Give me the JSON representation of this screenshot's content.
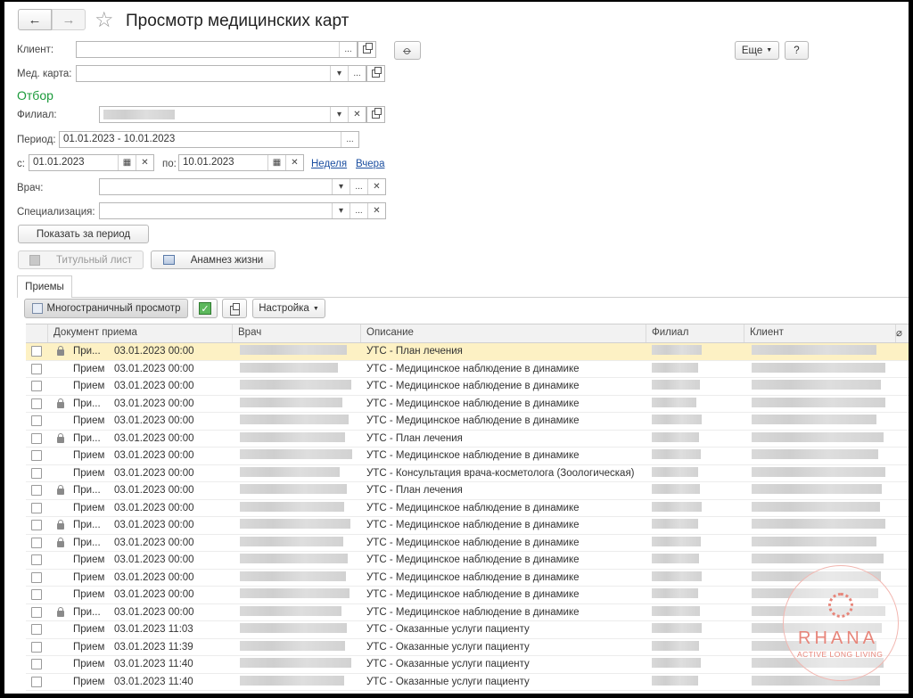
{
  "header": {
    "title": "Просмотр медицинских карт",
    "back_icon": "←",
    "forward_icon": "→",
    "star_icon": "☆"
  },
  "form": {
    "client_label": "Клиент:",
    "medcard_label": "Мед. карта:",
    "filter_title": "Отбор",
    "branch_label": "Филиал:",
    "period_label": "Период:",
    "period_value": "01.01.2023 - 10.01.2023",
    "from_label": "с:",
    "from_value": "01.01.2023",
    "to_label": "по:",
    "to_value": "10.01.2023",
    "week_link": "Неделя",
    "yesterday_link": "Вчера",
    "doctor_label": "Врач:",
    "spec_label": "Специализация:",
    "show_period_button": "Показать за период",
    "title_sheet_button": "Титульный лист",
    "anamnesis_button": "Анамнез жизни",
    "more_button": "Еще",
    "help_button": "?"
  },
  "tabs": [
    {
      "label": "Приемы"
    }
  ],
  "toolbar": {
    "multipage_button": "Многостраничный просмотр",
    "settings_button": "Настройка"
  },
  "table": {
    "columns": [
      "Документ приема",
      "Врач",
      "Описание",
      "Филиал",
      "Клиент"
    ],
    "rows": [
      {
        "doc": "При...",
        "date": "03.01.2023 00:00",
        "desc": "УТС - План лечения",
        "locked": true
      },
      {
        "doc": "Прием",
        "date": "03.01.2023 00:00",
        "desc": "УТС - Медицинское наблюдение в динамике",
        "locked": false
      },
      {
        "doc": "Прием",
        "date": "03.01.2023 00:00",
        "desc": "УТС - Медицинское наблюдение в динамике",
        "locked": false
      },
      {
        "doc": "При...",
        "date": "03.01.2023 00:00",
        "desc": "УТС - Медицинское наблюдение в динамике",
        "locked": true
      },
      {
        "doc": "Прием",
        "date": "03.01.2023 00:00",
        "desc": "УТС - Медицинское наблюдение в динамике",
        "locked": false
      },
      {
        "doc": "При...",
        "date": "03.01.2023 00:00",
        "desc": "УТС - План лечения",
        "locked": true
      },
      {
        "doc": "Прием",
        "date": "03.01.2023 00:00",
        "desc": "УТС - Медицинское наблюдение в динамике",
        "locked": false
      },
      {
        "doc": "Прием",
        "date": "03.01.2023 00:00",
        "desc": "УТС - Консультация врача-косметолога (Зоологическая)",
        "locked": false
      },
      {
        "doc": "При...",
        "date": "03.01.2023 00:00",
        "desc": "УТС - План лечения",
        "locked": true
      },
      {
        "doc": "Прием",
        "date": "03.01.2023 00:00",
        "desc": "УТС - Медицинское наблюдение в динамике",
        "locked": false
      },
      {
        "doc": "При...",
        "date": "03.01.2023 00:00",
        "desc": "УТС - Медицинское наблюдение в динамике",
        "locked": true
      },
      {
        "doc": "При...",
        "date": "03.01.2023 00:00",
        "desc": "УТС - Медицинское наблюдение в динамике",
        "locked": true
      },
      {
        "doc": "Прием",
        "date": "03.01.2023 00:00",
        "desc": "УТС - Медицинское наблюдение в динамике",
        "locked": false
      },
      {
        "doc": "Прием",
        "date": "03.01.2023 00:00",
        "desc": "УТС - Медицинское наблюдение в динамике",
        "locked": false
      },
      {
        "doc": "Прием",
        "date": "03.01.2023 00:00",
        "desc": "УТС - Медицинское наблюдение в динамике",
        "locked": false
      },
      {
        "doc": "При...",
        "date": "03.01.2023 00:00",
        "desc": "УТС - Медицинское наблюдение в динамике",
        "locked": true
      },
      {
        "doc": "Прием",
        "date": "03.01.2023 11:03",
        "desc": "УТС - Оказанные услуги пациенту",
        "locked": false
      },
      {
        "doc": "Прием",
        "date": "03.01.2023 11:39",
        "desc": "УТС - Оказанные услуги пациенту",
        "locked": false
      },
      {
        "doc": "Прием",
        "date": "03.01.2023 11:40",
        "desc": "УТС - Оказанные услуги пациенту",
        "locked": false
      },
      {
        "doc": "Прием",
        "date": "03.01.2023 11:40",
        "desc": "УТС - Оказанные услуги пациенту",
        "locked": false
      }
    ]
  },
  "watermark": {
    "brand": "RHANA",
    "tagline": "ACTIVE LONG LIVING"
  },
  "colors": {
    "accent_green": "#1a9a3a",
    "selected_row": "#fdf1c4",
    "link_blue": "#1c4fa0"
  }
}
